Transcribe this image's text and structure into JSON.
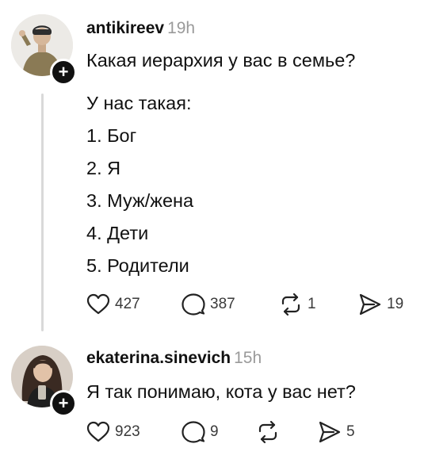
{
  "posts": [
    {
      "username": "antikireev",
      "time": "19h",
      "follow_icon": "+",
      "question": "Какая иерархия у вас в семье?",
      "lines": [
        "У нас такая:",
        "1. Бог",
        "2. Я",
        "3. Муж/жена",
        "4. Дети",
        "5. Родители"
      ],
      "likes": "427",
      "comments": "387",
      "reposts": "1",
      "shares": "19"
    },
    {
      "username": "ekaterina.sinevich",
      "time": "15h",
      "follow_icon": "+",
      "text": "Я так понимаю, кота у вас нет?",
      "likes": "923",
      "comments": "9",
      "reposts": "",
      "shares": "5"
    }
  ],
  "icons": [
    "heart-icon",
    "comment-icon",
    "repost-icon",
    "share-icon",
    "plus-icon"
  ],
  "colors": {
    "text": "#111111",
    "muted": "#9a9a9a",
    "thread_line": "#d9d9d9"
  }
}
